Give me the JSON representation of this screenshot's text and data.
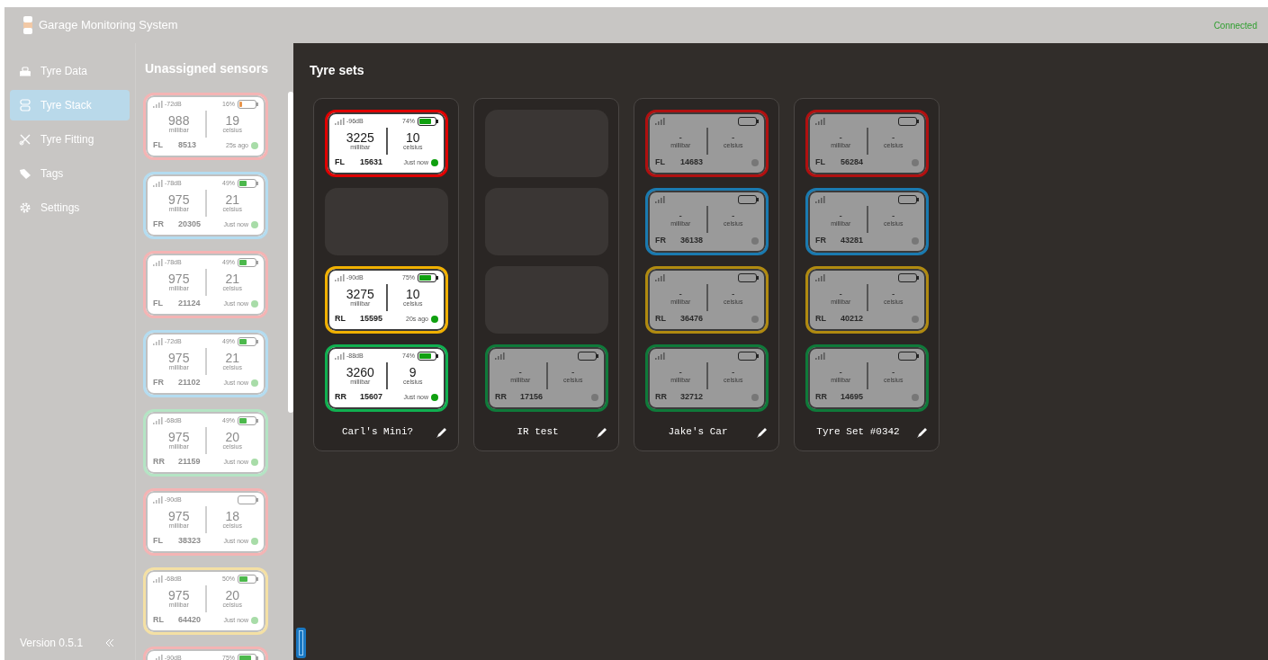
{
  "header": {
    "title": "Garage Monitoring System",
    "connection": "Connected"
  },
  "sidebar": {
    "items": [
      {
        "label": "Tyre Data",
        "selected": false
      },
      {
        "label": "Tyre Stack",
        "selected": true
      },
      {
        "label": "Tyre Fitting",
        "selected": false
      },
      {
        "label": "Tags",
        "selected": false
      },
      {
        "label": "Settings",
        "selected": false
      }
    ],
    "version": "Version 0.5.1"
  },
  "unassigned": {
    "title": "Unassigned sensors",
    "sensors": [
      {
        "signal": "-72dB",
        "battery_text": "16%",
        "level": 0.16,
        "pressure": "988",
        "pressure_unit": "millibar",
        "temperature": "19",
        "temperature_unit": "celsius",
        "position": "FL",
        "id": "8513",
        "time": "25s ago",
        "online": true,
        "color": "#f4b4b4"
      },
      {
        "signal": "-78dB",
        "battery_text": "49%",
        "level": 0.49,
        "pressure": "975",
        "pressure_unit": "millibar",
        "temperature": "21",
        "temperature_unit": "celsius",
        "position": "FR",
        "id": "20305",
        "time": "Just now",
        "online": true,
        "color": "#b4dcf0"
      },
      {
        "signal": "-78dB",
        "battery_text": "49%",
        "level": 0.49,
        "pressure": "975",
        "pressure_unit": "millibar",
        "temperature": "21",
        "temperature_unit": "celsius",
        "position": "FL",
        "id": "21124",
        "time": "Just now",
        "online": true,
        "color": "#f4b4b4"
      },
      {
        "signal": "-72dB",
        "battery_text": "49%",
        "level": 0.49,
        "pressure": "975",
        "pressure_unit": "millibar",
        "temperature": "21",
        "temperature_unit": "celsius",
        "position": "FR",
        "id": "21102",
        "time": "Just now",
        "online": true,
        "color": "#b4dcf0"
      },
      {
        "signal": "-68dB",
        "battery_text": "49%",
        "level": 0.49,
        "pressure": "975",
        "pressure_unit": "millibar",
        "temperature": "20",
        "temperature_unit": "celsius",
        "position": "RR",
        "id": "21159",
        "time": "Just now",
        "online": true,
        "color": "#b4e4c4"
      },
      {
        "signal": "-90dB",
        "pressure": "975",
        "pressure_unit": "millibar",
        "temperature": "18",
        "temperature_unit": "celsius",
        "position": "FL",
        "id": "38323",
        "time": "Just now",
        "online": true,
        "color": "#f4b4b4"
      },
      {
        "signal": "-68dB",
        "battery_text": "50%",
        "level": 0.5,
        "pressure": "975",
        "pressure_unit": "millibar",
        "temperature": "20",
        "temperature_unit": "celsius",
        "position": "RL",
        "id": "64420",
        "time": "Just now",
        "online": true,
        "color": "#f4e0a4"
      },
      {
        "signal": "-90dB",
        "battery_text": "75%",
        "level": 0.75,
        "color": "#f4b4b4"
      }
    ]
  },
  "tyre_sets": {
    "title": "Tyre sets",
    "sets": [
      {
        "name": "Carl's Mini?",
        "slots": [
          {
            "kind": "sensor",
            "signal": "-96dB",
            "battery_text": "74%",
            "level": 0.74,
            "pressure": "3225",
            "pressure_unit": "millibar",
            "temperature": "10",
            "temperature_unit": "celsius",
            "position": "FL",
            "id": "15631",
            "time": "Just now",
            "online": true,
            "color": "#e00000"
          },
          {
            "kind": "empty"
          },
          {
            "kind": "sensor",
            "signal": "-90dB",
            "battery_text": "75%",
            "level": 0.75,
            "pressure": "3275",
            "pressure_unit": "millibar",
            "temperature": "10",
            "temperature_unit": "celsius",
            "position": "RL",
            "id": "15595",
            "time": "20s ago",
            "online": true,
            "color": "#f0b000"
          },
          {
            "kind": "sensor",
            "signal": "-88dB",
            "battery_text": "74%",
            "level": 0.74,
            "pressure": "3260",
            "pressure_unit": "millibar",
            "temperature": "9",
            "temperature_unit": "celsius",
            "position": "RR",
            "id": "15607",
            "time": "Just now",
            "online": true,
            "color": "#10b050"
          }
        ]
      },
      {
        "name": "IR test",
        "slots": [
          {
            "kind": "empty"
          },
          {
            "kind": "empty"
          },
          {
            "kind": "empty"
          },
          {
            "kind": "sensor",
            "pressure": "-",
            "pressure_unit": "millibar",
            "temperature": "-",
            "temperature_unit": "celsius",
            "position": "RR",
            "id": "17156",
            "online": false,
            "color": "#0f7a3a"
          }
        ]
      },
      {
        "name": "Jake's Car",
        "slots": [
          {
            "kind": "sensor",
            "pressure": "-",
            "pressure_unit": "millibar",
            "temperature": "-",
            "temperature_unit": "celsius",
            "position": "FL",
            "id": "14683",
            "online": false,
            "color": "#b01010"
          },
          {
            "kind": "sensor",
            "pressure": "-",
            "pressure_unit": "millibar",
            "temperature": "-",
            "temperature_unit": "celsius",
            "position": "FR",
            "id": "36138",
            "online": false,
            "color": "#1a7ab0"
          },
          {
            "kind": "sensor",
            "pressure": "-",
            "pressure_unit": "millibar",
            "temperature": "-",
            "temperature_unit": "celsius",
            "position": "RL",
            "id": "36476",
            "online": false,
            "color": "#b08a10"
          },
          {
            "kind": "sensor",
            "pressure": "-",
            "pressure_unit": "millibar",
            "temperature": "-",
            "temperature_unit": "celsius",
            "position": "RR",
            "id": "32712",
            "online": false,
            "color": "#0f7a3a"
          }
        ]
      },
      {
        "name": "Tyre Set #0342",
        "slots": [
          {
            "kind": "sensor",
            "pressure": "-",
            "pressure_unit": "millibar",
            "temperature": "-",
            "temperature_unit": "celsius",
            "position": "FL",
            "id": "56284",
            "online": false,
            "color": "#b01010"
          },
          {
            "kind": "sensor",
            "pressure": "-",
            "pressure_unit": "millibar",
            "temperature": "-",
            "temperature_unit": "celsius",
            "position": "FR",
            "id": "43281",
            "online": false,
            "color": "#1a7ab0"
          },
          {
            "kind": "sensor",
            "pressure": "-",
            "pressure_unit": "millibar",
            "temperature": "-",
            "temperature_unit": "celsius",
            "position": "RL",
            "id": "40212",
            "online": false,
            "color": "#b08a10"
          },
          {
            "kind": "sensor",
            "pressure": "-",
            "pressure_unit": "millibar",
            "temperature": "-",
            "temperature_unit": "celsius",
            "position": "RR",
            "id": "14695",
            "online": false,
            "color": "#0f7a3a"
          }
        ]
      }
    ]
  }
}
